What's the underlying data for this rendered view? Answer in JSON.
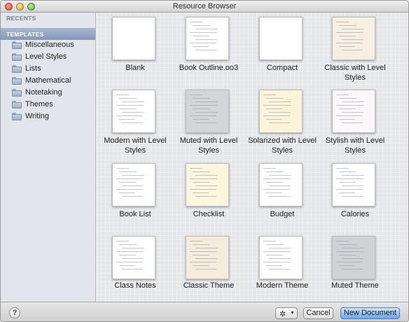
{
  "window": {
    "title": "Resource Browser"
  },
  "sidebar": {
    "recents_header": "RECENTS",
    "templates_header": "TEMPLATES",
    "items": [
      {
        "label": "Miscellaneous",
        "icon": "folder-icon"
      },
      {
        "label": "Level Styles",
        "icon": "folder-icon"
      },
      {
        "label": "Lists",
        "icon": "folder-icon"
      },
      {
        "label": "Mathematical",
        "icon": "folder-icon"
      },
      {
        "label": "Notetaking",
        "icon": "folder-icon"
      },
      {
        "label": "Themes",
        "icon": "folder-icon"
      },
      {
        "label": "Writing",
        "icon": "folder-icon"
      }
    ]
  },
  "templates": [
    {
      "name": "Blank",
      "bg": "#ffffff"
    },
    {
      "name": "Book Outline.oo3",
      "bg": "#ffffff"
    },
    {
      "name": "Compact",
      "bg": "#ffffff"
    },
    {
      "name": "Classic with Level Styles",
      "bg": "#f7efe2"
    },
    {
      "name": "Modern with Level Styles",
      "bg": "#ffffff"
    },
    {
      "name": "Muted with Level Styles",
      "bg": "#d3d5d9"
    },
    {
      "name": "Solarized with Level Styles",
      "bg": "#fbf3da"
    },
    {
      "name": "Stylish with Level Styles",
      "bg": "#fdf7f9"
    },
    {
      "name": "Book List",
      "bg": "#ffffff"
    },
    {
      "name": "Checklist",
      "bg": "#fbf6dd"
    },
    {
      "name": "Budget",
      "bg": "#ffffff"
    },
    {
      "name": "Calories",
      "bg": "#ffffff"
    },
    {
      "name": "Class Notes",
      "bg": "#ffffff"
    },
    {
      "name": "Classic Theme",
      "bg": "#f5ecde"
    },
    {
      "name": "Modern Theme",
      "bg": "#ffffff"
    },
    {
      "name": "Muted Theme",
      "bg": "#d0d2d6"
    }
  ],
  "footer": {
    "help_label": "?",
    "gear_icon": "gear-icon",
    "cancel_label": "Cancel",
    "new_document_label": "New Document"
  },
  "colors": {
    "sidebar_selection": "#8fa2c0",
    "primary_button": "#6aa5ea"
  }
}
